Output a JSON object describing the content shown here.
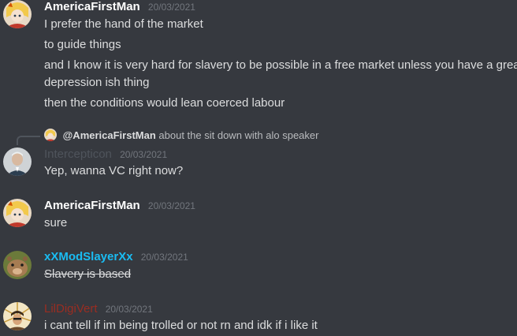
{
  "messages": [
    {
      "username": "AmericaFirstMan",
      "username_color": "#ffffff",
      "timestamp": "20/03/2021",
      "avatar": "anime-avatar-icon",
      "lines": [
        "I prefer the hand of the market",
        "to guide things",
        "and I know it is very hard for slavery to be possible in a free market unless you have a grea",
        "depression ish thing",
        "then the conditions would lean coerced labour"
      ]
    },
    {
      "reply": {
        "mention": "@AmericaFirstMan",
        "text": "about the sit down with alo speaker"
      },
      "username": "Intercepticon",
      "username_color": "#4f545c",
      "timestamp": "20/03/2021",
      "avatar": "portrait-avatar-icon",
      "lines": [
        "Yep, wanna VC right now?"
      ]
    },
    {
      "username": "AmericaFirstMan",
      "username_color": "#ffffff",
      "timestamp": "20/03/2021",
      "avatar": "anime-avatar-icon",
      "lines": [
        "sure"
      ]
    },
    {
      "username": "xXModSlayerXx",
      "username_color": "#1abcf2",
      "timestamp": "20/03/2021",
      "avatar": "animal-avatar-icon",
      "lines": [
        "Slavery is based"
      ]
    },
    {
      "username": "LilDigiVert",
      "username_color": "#992d22",
      "timestamp": "20/03/2021",
      "avatar": "sunburst-avatar-icon",
      "lines": [
        "i cant tell if im being trolled or not rn and idk if i like it"
      ]
    }
  ]
}
